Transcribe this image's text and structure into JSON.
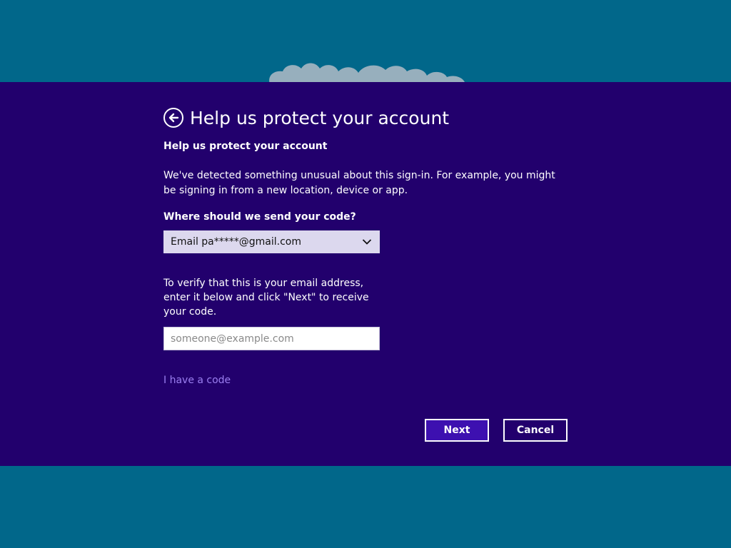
{
  "page": {
    "title": "Help us protect your account",
    "subheading": "Help us protect your account",
    "description": "We've detected something unusual about this sign-in. For example, you might be signing in from a new location, device or app."
  },
  "icons": {
    "back": "back-arrow-circle-icon",
    "dropdown": "chevron-down-icon",
    "logo": "cloud-logo"
  },
  "send_code": {
    "label": "Where should we send your code?",
    "selected_option": "Email pa*****@gmail.com"
  },
  "verify": {
    "instructions": "To verify that this is your email address, enter it below and click \"Next\" to receive your code.",
    "email_placeholder": "someone@example.com",
    "email_value": ""
  },
  "links": {
    "have_code": "I have a code"
  },
  "buttons": {
    "next": "Next",
    "cancel": "Cancel"
  },
  "colors": {
    "background_teal": "#01678a",
    "dialog_purple": "#22006d",
    "next_button": "#3d10b0",
    "link": "#9b7ff0",
    "select_bg": "#dcd8ee"
  }
}
